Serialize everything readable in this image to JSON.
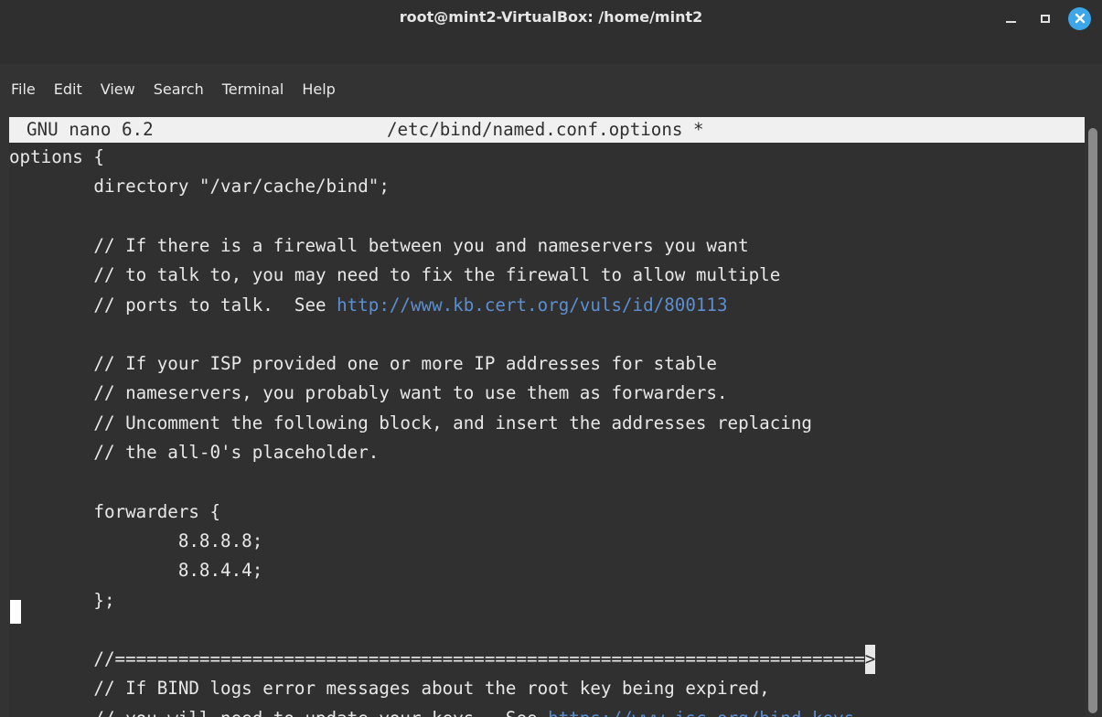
{
  "window": {
    "title": "root@mint2-VirtualBox: /home/mint2",
    "accent": "#3da6e8"
  },
  "menu": {
    "items": [
      "File",
      "Edit",
      "View",
      "Search",
      "Terminal",
      "Help"
    ]
  },
  "nano": {
    "version": "GNU nano 6.2",
    "filename": "/etc/bind/named.conf.options *",
    "lines": [
      {
        "text": "options {"
      },
      {
        "text": "        directory \"/var/cache/bind\";"
      },
      {
        "text": ""
      },
      {
        "text": "        // If there is a firewall between you and nameservers you want"
      },
      {
        "text": "        // to talk to, you may need to fix the firewall to allow multiple"
      },
      {
        "text": "        // ports to talk.  See ",
        "url": "http://www.kb.cert.org/vuls/id/800113"
      },
      {
        "text": ""
      },
      {
        "text": "        // If your ISP provided one or more IP addresses for stable"
      },
      {
        "text": "        // nameservers, you probably want to use them as forwarders."
      },
      {
        "text": "        // Uncomment the following block, and insert the addresses replacing"
      },
      {
        "text": "        // the all-0's placeholder."
      },
      {
        "text": ""
      },
      {
        "text": "        forwarders {"
      },
      {
        "text": "                8.8.8.8;"
      },
      {
        "text": "                8.8.4.4;"
      },
      {
        "text": "        };"
      },
      {
        "text": ""
      },
      {
        "text": "        //=============================================================",
        "overflow": ">"
      },
      {
        "text": "        // If BIND logs error messages about the root key being expired,"
      },
      {
        "text": "        // you will need to update your keys.  See ",
        "url": "https://www.isc.org/bind-keys"
      }
    ]
  }
}
